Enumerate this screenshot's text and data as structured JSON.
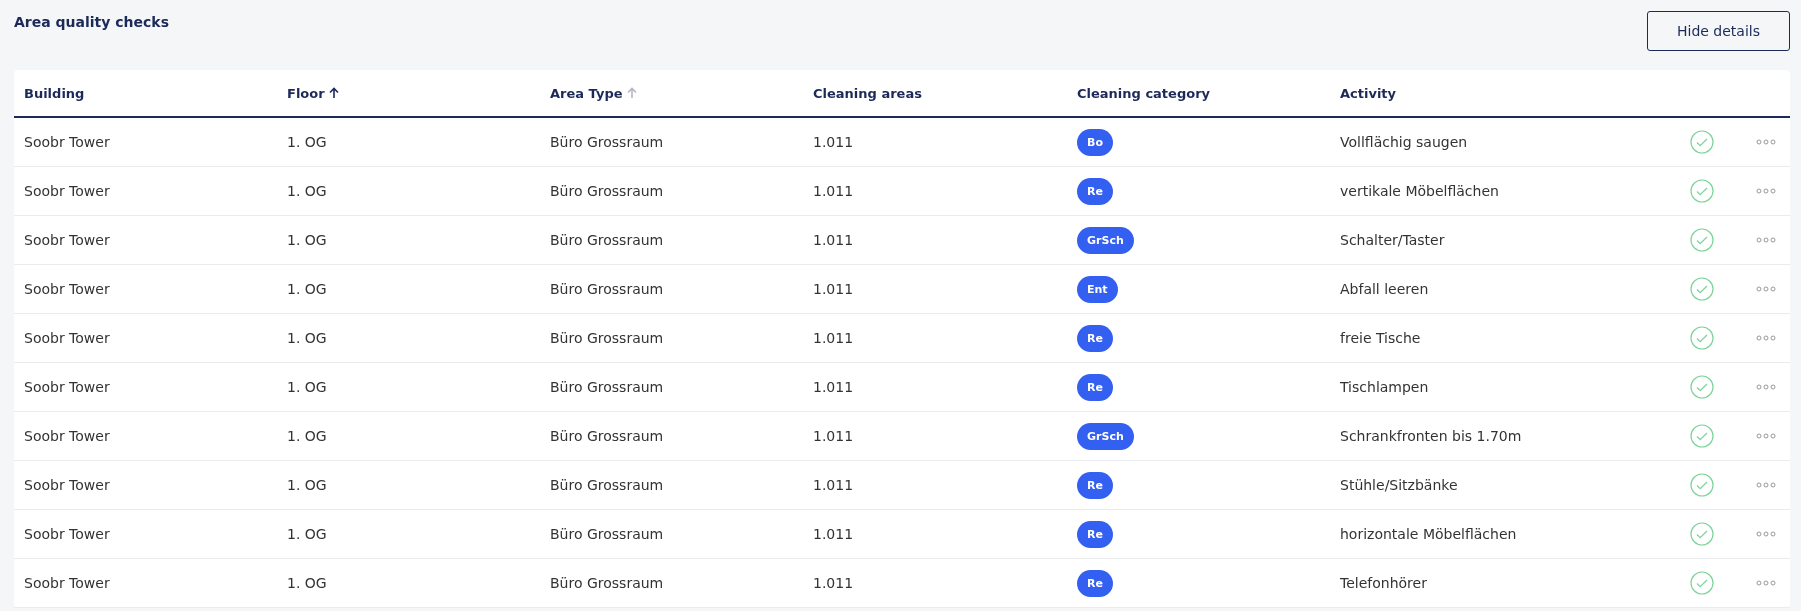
{
  "title": "Area quality checks",
  "toggle_button": "Hide details",
  "table": {
    "columns": [
      {
        "label": "Building"
      },
      {
        "label": "Floor",
        "sort_active": true
      },
      {
        "label": "Area Type",
        "sort_active": false
      },
      {
        "label": "Cleaning areas"
      },
      {
        "label": "Cleaning category"
      },
      {
        "label": "Activity"
      }
    ],
    "rows": [
      {
        "building": "Soobr Tower",
        "floor": "1. OG",
        "area_type": "Büro Grossraum",
        "cleaning_areas": "1.011",
        "category": "Bo",
        "activity": "Vollflächig saugen",
        "done": true
      },
      {
        "building": "Soobr Tower",
        "floor": "1. OG",
        "area_type": "Büro Grossraum",
        "cleaning_areas": "1.011",
        "category": "Re",
        "activity": "vertikale Möbelflächen",
        "done": true
      },
      {
        "building": "Soobr Tower",
        "floor": "1. OG",
        "area_type": "Büro Grossraum",
        "cleaning_areas": "1.011",
        "category": "GrSch",
        "activity": "Schalter/Taster",
        "done": true
      },
      {
        "building": "Soobr Tower",
        "floor": "1. OG",
        "area_type": "Büro Grossraum",
        "cleaning_areas": "1.011",
        "category": "Ent",
        "activity": "Abfall leeren",
        "done": true
      },
      {
        "building": "Soobr Tower",
        "floor": "1. OG",
        "area_type": "Büro Grossraum",
        "cleaning_areas": "1.011",
        "category": "Re",
        "activity": "freie Tische",
        "done": true
      },
      {
        "building": "Soobr Tower",
        "floor": "1. OG",
        "area_type": "Büro Grossraum",
        "cleaning_areas": "1.011",
        "category": "Re",
        "activity": "Tischlampen",
        "done": true
      },
      {
        "building": "Soobr Tower",
        "floor": "1. OG",
        "area_type": "Büro Grossraum",
        "cleaning_areas": "1.011",
        "category": "GrSch",
        "activity": "Schrankfronten bis 1.70m",
        "done": true
      },
      {
        "building": "Soobr Tower",
        "floor": "1. OG",
        "area_type": "Büro Grossraum",
        "cleaning_areas": "1.011",
        "category": "Re",
        "activity": "Stühle/Sitzbänke",
        "done": true
      },
      {
        "building": "Soobr Tower",
        "floor": "1. OG",
        "area_type": "Büro Grossraum",
        "cleaning_areas": "1.011",
        "category": "Re",
        "activity": "horizontale Möbelflächen",
        "done": true
      },
      {
        "building": "Soobr Tower",
        "floor": "1. OG",
        "area_type": "Büro Grossraum",
        "cleaning_areas": "1.011",
        "category": "Re",
        "activity": "Telefonhörer",
        "done": true
      }
    ]
  }
}
